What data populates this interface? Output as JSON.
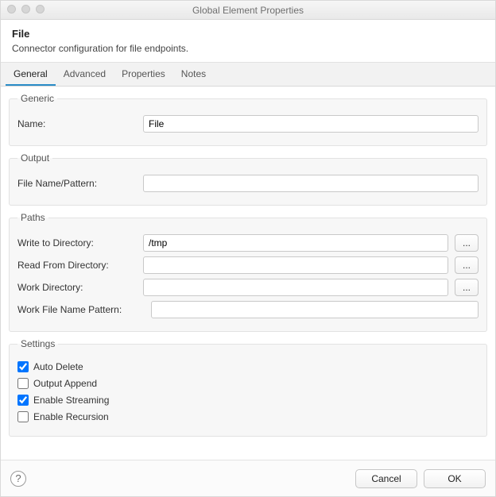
{
  "window": {
    "title": "Global Element Properties"
  },
  "header": {
    "heading": "File",
    "description": "Connector configuration for file endpoints."
  },
  "tabs": [
    {
      "label": "General",
      "active": true
    },
    {
      "label": "Advanced",
      "active": false
    },
    {
      "label": "Properties",
      "active": false
    },
    {
      "label": "Notes",
      "active": false
    }
  ],
  "groups": {
    "generic": {
      "legend": "Generic",
      "name_label": "Name:",
      "name_value": "File"
    },
    "output": {
      "legend": "Output",
      "file_name_pattern_label": "File Name/Pattern:",
      "file_name_pattern_value": ""
    },
    "paths": {
      "legend": "Paths",
      "write_dir_label": "Write to Directory:",
      "write_dir_value": "/tmp",
      "read_dir_label": "Read From Directory:",
      "read_dir_value": "",
      "work_dir_label": "Work Directory:",
      "work_dir_value": "",
      "work_file_pattern_label": "Work File Name Pattern:",
      "work_file_pattern_value": "",
      "browse_label": "..."
    },
    "settings": {
      "legend": "Settings",
      "auto_delete_label": "Auto Delete",
      "auto_delete_checked": true,
      "output_append_label": "Output Append",
      "output_append_checked": false,
      "enable_streaming_label": "Enable Streaming",
      "enable_streaming_checked": true,
      "enable_recursion_label": "Enable Recursion",
      "enable_recursion_checked": false
    }
  },
  "footer": {
    "help_glyph": "?",
    "cancel_label": "Cancel",
    "ok_label": "OK"
  }
}
